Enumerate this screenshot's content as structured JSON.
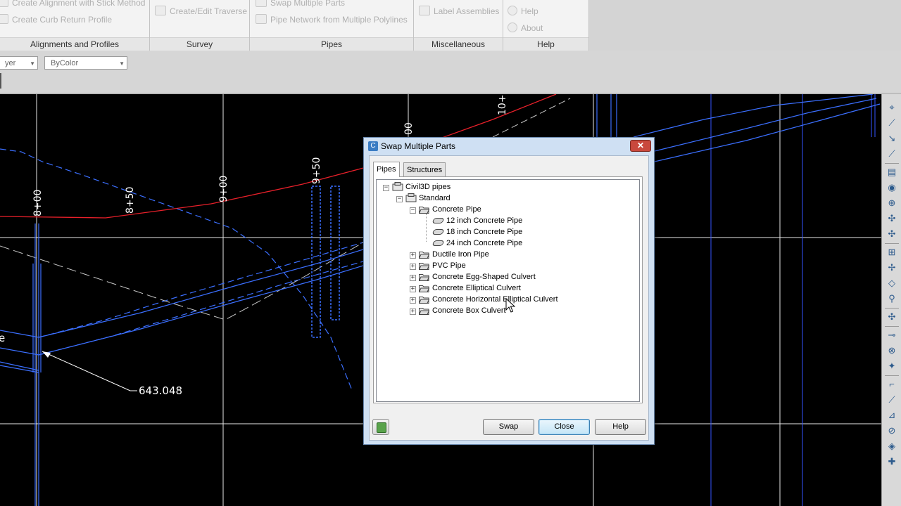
{
  "ribbon": {
    "panels": [
      {
        "label": "Alignments and Profiles",
        "commands": [
          "Create Alignment with Stick Method",
          "Create Curb Return Profile"
        ]
      },
      {
        "label": "Survey",
        "commands": [
          "Create/Edit Traverse"
        ]
      },
      {
        "label": "Pipes",
        "commands": [
          "Swap Multiple Parts",
          "Pipe Network from Multiple Polylines"
        ]
      },
      {
        "label": "Miscellaneous",
        "commands": [
          "Label Assemblies"
        ]
      },
      {
        "label": "Help",
        "commands": [
          "Help",
          "About"
        ]
      }
    ]
  },
  "properties": {
    "layer_combo": "yer",
    "color_combo": "ByColor"
  },
  "drawing": {
    "stations": [
      "8+00",
      "8+50",
      "9+00",
      "9+50",
      "00",
      "10+"
    ],
    "dimension_text": "643.048",
    "partial_label": "e",
    "colors": {
      "background": "#000000",
      "pipe_lines": "#3b6fff",
      "profile_line": "#e8202a",
      "grid": "#ffffff"
    }
  },
  "dialog": {
    "title": "Swap Multiple Parts",
    "close_glyph": "✕",
    "tabs": [
      "Pipes",
      "Structures"
    ],
    "active_tab": "Pipes",
    "tree": {
      "root": "Civil3D pipes",
      "catalog": "Standard",
      "expanded_family": "Concrete Pipe",
      "parts": [
        "12 inch Concrete Pipe",
        "18 inch Concrete Pipe",
        "24 inch Concrete Pipe"
      ],
      "families": [
        "Ductile Iron Pipe",
        "PVC Pipe",
        "Concrete Egg-Shaped Culvert",
        "Concrete Elliptical Culvert",
        "Concrete Horizontal Elliptical Culvert",
        "Concrete Box Culvert"
      ]
    },
    "buttons": {
      "swap": "Swap",
      "close": "Close",
      "help": "Help"
    }
  },
  "icons": [
    "app-icon",
    "folder-icon",
    "pipe-icon",
    "network-icon",
    "help-book-icon",
    "mouse-cursor-icon"
  ]
}
